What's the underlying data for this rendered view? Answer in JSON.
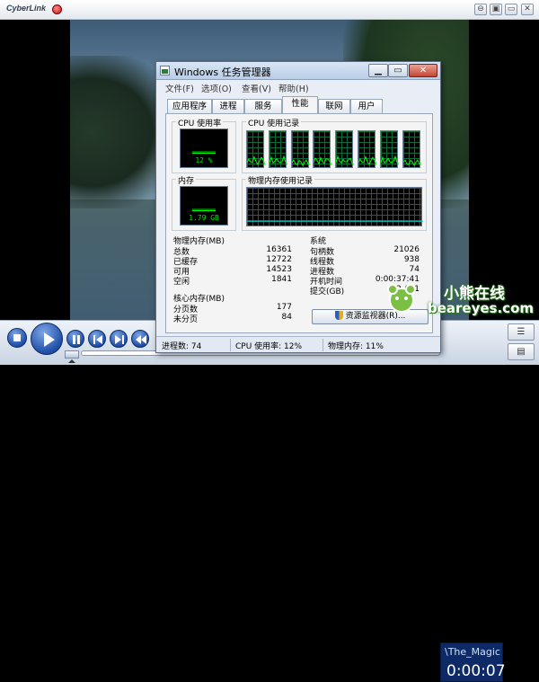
{
  "player": {
    "brand": "CyberLink",
    "window_controls": [
      "⊖",
      "▣",
      "▭",
      "✕"
    ],
    "media_title": "\\The_Magic",
    "elapsed_time": "0:00:07",
    "progress": 0,
    "icons": {
      "stop": "stop-icon",
      "play": "play-icon",
      "prev": "previous-icon",
      "next": "next-icon",
      "rewind": "rewind-icon",
      "eject": "eject-icon"
    },
    "menu_icons": [
      "menu-icon",
      "playlist-icon"
    ]
  },
  "taskmgr": {
    "title": "Windows 任务管理器",
    "controls": {
      "minimize": "▁",
      "maximize": "▭",
      "close": "✕"
    },
    "menu": [
      "文件(F)",
      "选项(O)",
      "查看(V)",
      "帮助(H)"
    ],
    "tabs": [
      "应用程序",
      "进程",
      "服务",
      "性能",
      "联网",
      "用户"
    ],
    "active_tab": "性能",
    "cpu_usage": {
      "label": "CPU 使用率",
      "value": "12 %",
      "percent": 12
    },
    "cpu_history": {
      "label": "CPU 使用记录",
      "cores": 8
    },
    "memory": {
      "label": "内存",
      "value": "1.79 GB",
      "percent": 11
    },
    "memory_history": {
      "label": "物理内存使用记录"
    },
    "physical_memory": {
      "label": "物理内存(MB)",
      "rows": [
        {
          "k": "总数",
          "v": "16361"
        },
        {
          "k": "已缓存",
          "v": "12722"
        },
        {
          "k": "可用",
          "v": "14523"
        },
        {
          "k": "空闲",
          "v": "1841"
        }
      ]
    },
    "kernel_memory": {
      "label": "核心内存(MB)",
      "rows": [
        {
          "k": "分页数",
          "v": "177"
        },
        {
          "k": "未分页",
          "v": "84"
        }
      ]
    },
    "system": {
      "label": "系统",
      "rows": [
        {
          "k": "句柄数",
          "v": "21026"
        },
        {
          "k": "线程数",
          "v": "938"
        },
        {
          "k": "进程数",
          "v": "74"
        },
        {
          "k": "开机时间",
          "v": "0:00:37:41"
        },
        {
          "k": "提交(GB)",
          "v": "2 / 31"
        }
      ]
    },
    "resmon_button": "资源监视器(R)...",
    "status": {
      "processes": "进程数: 74",
      "cpu": "CPU 使用率: 12%",
      "memory": "物理内存: 11%"
    }
  },
  "watermark": {
    "cn": "小熊在线",
    "en": "beareyes.com"
  }
}
